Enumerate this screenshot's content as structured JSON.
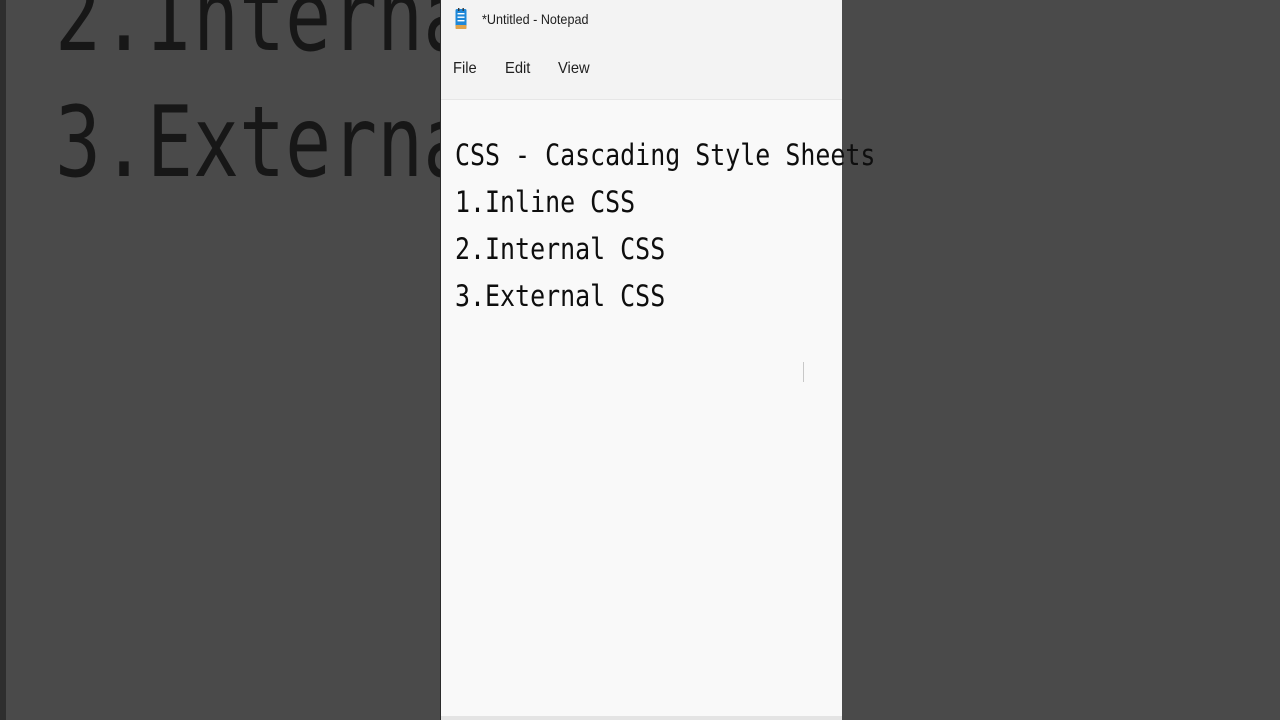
{
  "background": {
    "lines": [
      "2.Interna",
      "3.Externa"
    ]
  },
  "window": {
    "title": "*Untitled - Notepad",
    "icon": "notepad-icon"
  },
  "menu": {
    "file": "File",
    "edit": "Edit",
    "view": "View"
  },
  "editor": {
    "lines": [
      "CSS - Cascading Style Sheets",
      "1.Inline CSS",
      "2.Internal CSS",
      "3.External CSS"
    ]
  },
  "colors": {
    "backdrop": "#4a4a4a",
    "window": "#f9f9f9",
    "chrome": "#f3f3f3",
    "text": "#0e0e0e",
    "icon_blue": "#1e88d8"
  }
}
